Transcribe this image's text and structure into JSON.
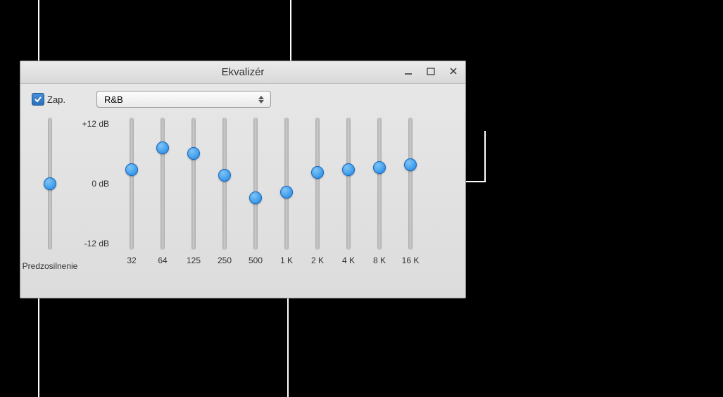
{
  "window": {
    "title": "Ekvalizér"
  },
  "checkbox": {
    "label": "Zap.",
    "checked": true
  },
  "preset": {
    "selected": "R&B"
  },
  "scale": {
    "max": "+12 dB",
    "mid": "0 dB",
    "min": "-12 dB"
  },
  "preamp": {
    "label": "Predzosilnenie",
    "value": 0
  },
  "bands": [
    {
      "freq": "32",
      "value": 2.5
    },
    {
      "freq": "64",
      "value": 6.5
    },
    {
      "freq": "125",
      "value": 5.5
    },
    {
      "freq": "250",
      "value": 1.5
    },
    {
      "freq": "500",
      "value": -2.5
    },
    {
      "freq": "1 K",
      "value": -1.5
    },
    {
      "freq": "2 K",
      "value": 2.0
    },
    {
      "freq": "4 K",
      "value": 2.5
    },
    {
      "freq": "8 K",
      "value": 3.0
    },
    {
      "freq": "16 K",
      "value": 3.5
    }
  ],
  "range": {
    "min": -12,
    "max": 12
  }
}
